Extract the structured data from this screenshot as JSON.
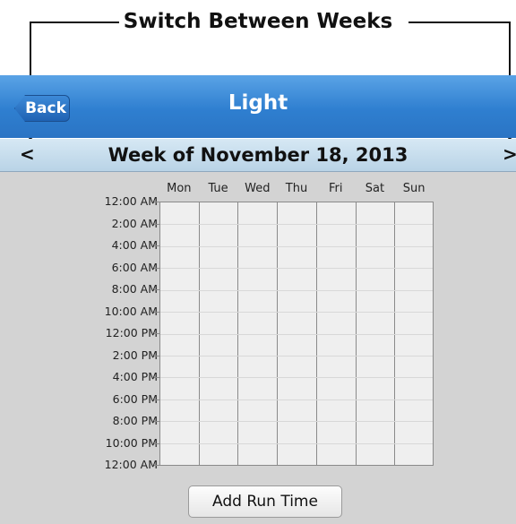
{
  "annotation": {
    "text": "Switch Between Weeks"
  },
  "header": {
    "back_label": "Back",
    "title": "Light",
    "color": "#2f7fd0"
  },
  "week_nav": {
    "prev_label": "<",
    "next_label": ">",
    "title": "Week of November 18, 2013"
  },
  "schedule": {
    "days": [
      "Mon",
      "Tue",
      "Wed",
      "Thu",
      "Fri",
      "Sat",
      "Sun"
    ],
    "times": [
      "12:00 AM",
      "2:00 AM",
      "4:00 AM",
      "6:00 AM",
      "8:00 AM",
      "10:00 AM",
      "12:00 PM",
      "2:00 PM",
      "4:00 PM",
      "6:00 PM",
      "8:00 PM",
      "10:00 PM",
      "12:00 AM"
    ]
  },
  "footer": {
    "add_label": "Add Run Time"
  }
}
